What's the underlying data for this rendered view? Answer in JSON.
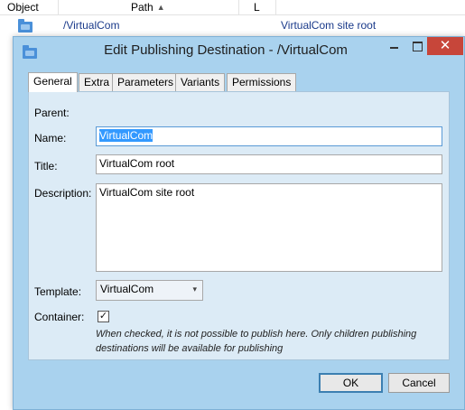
{
  "background_list": {
    "columns": {
      "object": "Object",
      "path": "Path",
      "l": "L"
    },
    "sort_indicator": "▲",
    "row": {
      "icon": "folder-icon",
      "path": "/VirtualCom",
      "name": "VirtualCom site root"
    }
  },
  "dialog": {
    "icon": "folder-icon",
    "title": "Edit Publishing Destination - /VirtualCom",
    "window_buttons": {
      "minimize": "minimize",
      "maximize": "maximize",
      "close": "✕"
    },
    "tabs": [
      {
        "label": "General",
        "active": true
      },
      {
        "label": "Extra",
        "active": false
      },
      {
        "label": "Parameters",
        "active": false
      },
      {
        "label": "Variants",
        "active": false
      },
      {
        "label": "Permissions",
        "active": false
      }
    ],
    "form": {
      "parent_label": "Parent:",
      "name_label": "Name:",
      "name_value": "VirtualCom",
      "title_label": "Title:",
      "title_value": "VirtualCom root",
      "description_label": "Description:",
      "description_value": "VirtualCom site root",
      "template_label": "Template:",
      "template_value": "VirtualCom",
      "container_label": "Container:",
      "container_checked": true,
      "container_hint_line1": "When checked, it is not possible to publish here. Only children publishing",
      "container_hint_line2": "destinations will be available for publishing"
    },
    "buttons": {
      "ok": "OK",
      "cancel": "Cancel"
    }
  },
  "colors": {
    "dialog_background": "#a9d2ee",
    "panel_background": "#dcebf6",
    "close_button": "#c7463a",
    "selection": "#3399ff"
  }
}
